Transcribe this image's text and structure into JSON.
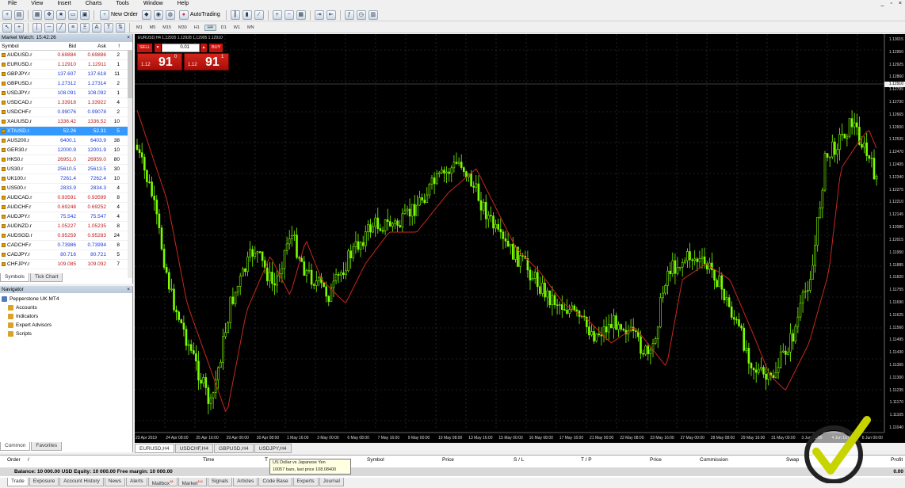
{
  "menu": {
    "items": [
      "File",
      "View",
      "Insert",
      "Charts",
      "Tools",
      "Window",
      "Help"
    ]
  },
  "toolbar": {
    "new_order_label": "New Order",
    "autotrading_label": "AutoTrading",
    "timeframes": [
      "M1",
      "M5",
      "M15",
      "M30",
      "H1",
      "H4",
      "D1",
      "W1",
      "MN"
    ],
    "active_timeframe": "H4"
  },
  "market_watch": {
    "title": "Market Watch: 15:42:26",
    "close_glyph": "×",
    "columns": {
      "symbol": "Symbol",
      "bid": "Bid",
      "ask": "Ask",
      "spread": "!"
    },
    "rows": [
      {
        "symbol": "AUDUSD.r",
        "bid": "0.69884",
        "ask": "0.69886",
        "spread": "2",
        "dir": "down"
      },
      {
        "symbol": "EURUSD.r",
        "bid": "1.12910",
        "ask": "1.12911",
        "spread": "1",
        "dir": "down"
      },
      {
        "symbol": "GBPJPY.r",
        "bid": "137.607",
        "ask": "137.618",
        "spread": "11",
        "dir": "up"
      },
      {
        "symbol": "GBPUSD.r",
        "bid": "1.27312",
        "ask": "1.27314",
        "spread": "2",
        "dir": "up"
      },
      {
        "symbol": "USDJPY.r",
        "bid": "108.091",
        "ask": "108.092",
        "spread": "1",
        "dir": "up"
      },
      {
        "symbol": "USDCAD.r",
        "bid": "1.33918",
        "ask": "1.33922",
        "spread": "4",
        "dir": "down"
      },
      {
        "symbol": "USDCHF.r",
        "bid": "0.99076",
        "ask": "0.99078",
        "spread": "2",
        "dir": "up"
      },
      {
        "symbol": "XAUUSD.r",
        "bid": "1336.42",
        "ask": "1336.52",
        "spread": "10",
        "dir": "down"
      },
      {
        "symbol": "XTIUSD.r",
        "bid": "52.26",
        "ask": "52.31",
        "spread": "5",
        "dir": "up",
        "selected": true
      },
      {
        "symbol": "AUS200.r",
        "bid": "6400.1",
        "ask": "6403.9",
        "spread": "38",
        "dir": "up"
      },
      {
        "symbol": "GER30.r",
        "bid": "12000.9",
        "ask": "12001.9",
        "spread": "10",
        "dir": "up"
      },
      {
        "symbol": "HK50.r",
        "bid": "26951.0",
        "ask": "26959.0",
        "spread": "80",
        "dir": "down"
      },
      {
        "symbol": "US30.r",
        "bid": "25610.5",
        "ask": "25613.5",
        "spread": "30",
        "dir": "up"
      },
      {
        "symbol": "UK100.r",
        "bid": "7261.4",
        "ask": "7262.4",
        "spread": "10",
        "dir": "up"
      },
      {
        "symbol": "US500.r",
        "bid": "2833.9",
        "ask": "2834.3",
        "spread": "4",
        "dir": "up"
      },
      {
        "symbol": "AUDCAD.r",
        "bid": "0.93591",
        "ask": "0.93599",
        "spread": "8",
        "dir": "down"
      },
      {
        "symbol": "AUDCHF.r",
        "bid": "0.69248",
        "ask": "0.69252",
        "spread": "4",
        "dir": "down"
      },
      {
        "symbol": "AUDJPY.r",
        "bid": "75.542",
        "ask": "75.547",
        "spread": "4",
        "dir": "up"
      },
      {
        "symbol": "AUDNZD.r",
        "bid": "1.05227",
        "ask": "1.05235",
        "spread": "8",
        "dir": "down"
      },
      {
        "symbol": "AUDSGD.r",
        "bid": "0.95259",
        "ask": "0.95283",
        "spread": "24",
        "dir": "down"
      },
      {
        "symbol": "CADCHF.r",
        "bid": "0.73986",
        "ask": "0.73994",
        "spread": "8",
        "dir": "up"
      },
      {
        "symbol": "CADJPY.r",
        "bid": "80.716",
        "ask": "80.721",
        "spread": "5",
        "dir": "up"
      },
      {
        "symbol": "CHFJPY.r",
        "bid": "109.085",
        "ask": "109.092",
        "spread": "7",
        "dir": "down"
      }
    ],
    "tabs": [
      "Symbols",
      "Tick Chart"
    ],
    "active_tab": "Symbols"
  },
  "navigator": {
    "title": "Navigator",
    "close_glyph": "×",
    "items": [
      {
        "label": "Pepperstone UK MT4",
        "indent": 0,
        "color": "#4f7cbf"
      },
      {
        "label": "Accounts",
        "indent": 1,
        "color": "#d9a326"
      },
      {
        "label": "Indicators",
        "indent": 1,
        "color": "#d9a326"
      },
      {
        "label": "Expert Advisors",
        "indent": 1,
        "color": "#d9a326"
      },
      {
        "label": "Scripts",
        "indent": 1,
        "color": "#d9a326"
      }
    ],
    "tabs": [
      "Common",
      "Favorites"
    ],
    "active_tab": "Common"
  },
  "chart": {
    "header": "EURUSD,H4  1.12935 1.12928 1.12905 1.12910",
    "sell_label": "SELL",
    "buy_label": "BUY",
    "lot_value": "0.01",
    "sell_price_small": "1.12",
    "sell_price_big": "91",
    "sell_price_sup": "0",
    "buy_price_small": "1.12",
    "buy_price_big": "91",
    "buy_price_sup": "1",
    "price_ticks": [
      "1.13015",
      "1.12950",
      "1.12925",
      "1.12860",
      "1.12795",
      "1.12730",
      "1.12665",
      "1.12600",
      "1.12535",
      "1.12470",
      "1.12405",
      "1.12340",
      "1.12275",
      "1.12210",
      "1.12145",
      "1.12080",
      "1.12015",
      "1.11950",
      "1.11885",
      "1.11820",
      "1.11755",
      "1.11690",
      "1.11625",
      "1.11560",
      "1.11495",
      "1.11430",
      "1.11365",
      "1.11300",
      "1.11235",
      "1.11170",
      "1.11105",
      "1.11040"
    ],
    "current_price_label": "1.12910",
    "time_ticks": [
      "23 Apr 2019",
      "24 Apr 08:00",
      "25 Apr 16:00",
      "29 Apr 00:00",
      "30 Apr 08:00",
      "1 May 16:00",
      "3 May 00:00",
      "6 May 08:00",
      "7 May 16:00",
      "9 May 00:00",
      "10 May 08:00",
      "13 May 16:00",
      "15 May 00:00",
      "16 May 08:00",
      "17 May 16:00",
      "21 May 00:00",
      "22 May 08:00",
      "23 May 16:00",
      "27 May 00:00",
      "28 May 08:00",
      "29 May 16:00",
      "31 May 00:00",
      "3 Jun 08:00",
      "4 Jun 16:00",
      "6 Jun 00:00"
    ],
    "bull_color": "#7cfc00",
    "bear_color": "#7cfc00",
    "ma_color": "#c8281e",
    "grid_color": "#3a3a3a"
  },
  "chart_tabs": {
    "items": [
      "EURUSD,H4",
      "USDCHF,H4",
      "GBPUSD,H4",
      "USDJPY,H4"
    ],
    "active": "EURUSD,H4"
  },
  "tooltip": {
    "line1": "US Dollar vs Japanese Yen",
    "line2": "10057 bars, last price 108.08400"
  },
  "terminal": {
    "columns": [
      "Order",
      "/",
      "Time",
      "T",
      "Symbol",
      "Price",
      "S / L",
      "T / P",
      "Price",
      "Commission",
      "Swap",
      "Profit"
    ],
    "balance_line": "Balance: 10 000.00 USD  Equity: 10 000.00  Free margin: 10 000.00",
    "profit_total": "0.00",
    "tabs": [
      "Trade",
      "Exposure",
      "Account History",
      "News",
      "Alerts",
      "Mailbox",
      "Market",
      "Signals",
      "Articles",
      "Code Base",
      "Experts",
      "Journal"
    ],
    "active_tab": "Trade",
    "mailbox_badge": "18",
    "market_badge": "114"
  }
}
